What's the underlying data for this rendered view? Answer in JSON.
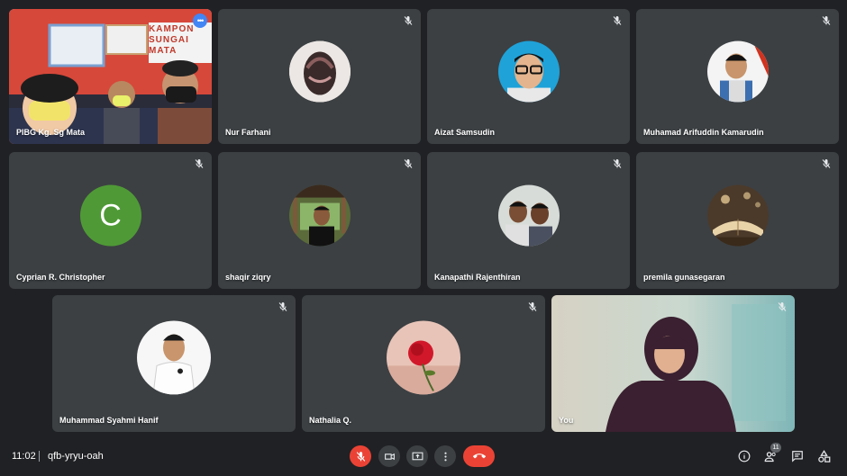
{
  "meeting": {
    "time": "11:02",
    "separator": "|",
    "code": "qfb-yryu-oah",
    "participant_count": "11"
  },
  "participants": [
    {
      "name": "PIBG Kg. Sg Mata",
      "type": "video",
      "sign_text": "KAMPON SUNGAI MATA"
    },
    {
      "name": "Nur Farhani",
      "type": "photo",
      "muted": true
    },
    {
      "name": "Aizat Samsudin",
      "type": "photo",
      "muted": true
    },
    {
      "name": "Muhamad Arifuddin Kamarudin",
      "type": "photo",
      "muted": true
    },
    {
      "name": "Cyprian R. Christopher",
      "type": "letter",
      "letter": "C",
      "muted": true
    },
    {
      "name": "shaqir ziqry",
      "type": "photo",
      "muted": true
    },
    {
      "name": "Kanapathi Rajenthiran",
      "type": "photo",
      "muted": true
    },
    {
      "name": "premila gunasegaran",
      "type": "photo",
      "muted": true
    },
    {
      "name": "Muhammad Syahmi Hanif",
      "type": "photo",
      "muted": true
    },
    {
      "name": "Nathalia Q.",
      "type": "photo",
      "muted": true
    },
    {
      "name": "You",
      "type": "video",
      "muted": true
    }
  ],
  "colors": {
    "background": "#202124",
    "tile": "#3c4043",
    "accent_blue": "#8ab4f8",
    "end_call_red": "#ea4335",
    "avatar_green": "#4f9a36"
  },
  "icons": {
    "mic": "mic-off-icon",
    "camera": "camera-icon",
    "present": "present-screen-icon",
    "more": "more-vert-icon",
    "end": "call-end-icon",
    "info": "info-icon",
    "people": "people-icon",
    "chat": "chat-icon",
    "activities": "activities-icon"
  }
}
